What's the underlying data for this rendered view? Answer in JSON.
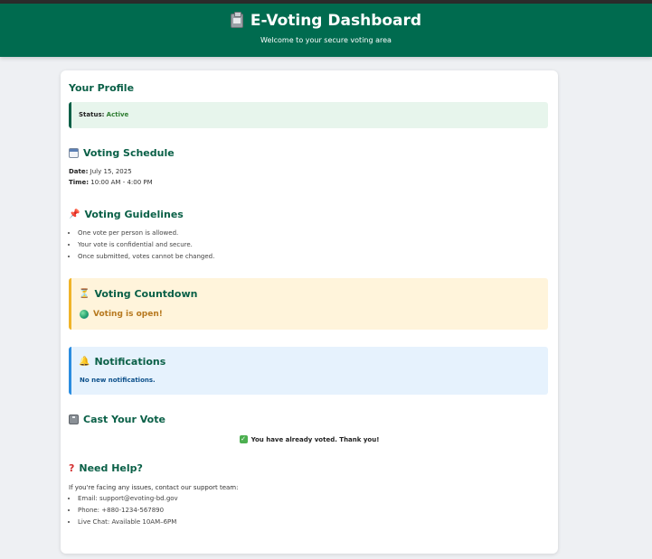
{
  "header": {
    "icon": "clipboard-icon",
    "title": "E-Voting Dashboard",
    "subtitle": "Welcome to your secure voting area"
  },
  "profile": {
    "title": "Your Profile",
    "status_label": "Status:",
    "status_value": "Active"
  },
  "schedule": {
    "icon": "calendar-icon",
    "title": "Voting Schedule",
    "date_label": "Date:",
    "date_value": "July 15, 2025",
    "time_label": "Time:",
    "time_value": "10:00 AM - 4:00 PM"
  },
  "guidelines": {
    "icon": "pushpin-icon",
    "title": "Voting Guidelines",
    "items": [
      "One vote per person is allowed.",
      "Your vote is confidential and secure.",
      "Once submitted, votes cannot be changed."
    ]
  },
  "countdown": {
    "icon": "hourglass-icon",
    "title": "Voting Countdown",
    "status_icon": "globe-icon",
    "status_text": "Voting is open!"
  },
  "notifications": {
    "icon": "bell-icon",
    "title": "Notifications",
    "text": "No new notifications."
  },
  "cast_vote": {
    "icon": "ballot-box-icon",
    "title": "Cast Your Vote",
    "message_icon": "check-mark-icon",
    "message": "You have already voted. Thank you!"
  },
  "help": {
    "icon": "question-icon",
    "title": "Need Help?",
    "intro": "If you're facing any issues, contact our support team:",
    "items": [
      "Email: support@evoting-bd.gov",
      "Phone: +880-1234-567890",
      "Live Chat: Available 10AM–6PM"
    ]
  },
  "colors": {
    "header_bg": "#006b4f",
    "accent_green": "#0a6047",
    "status_active": "#2e7d32",
    "countdown_border": "#f0b429",
    "notification_border": "#2b8de0"
  }
}
